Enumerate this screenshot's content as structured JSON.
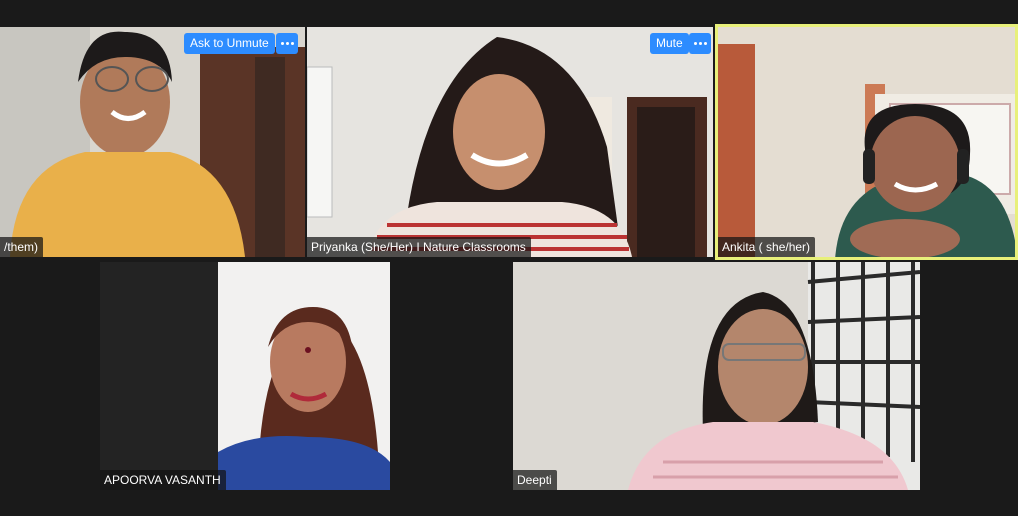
{
  "participants": [
    {
      "name": "/them)",
      "action": "Ask to Unmute"
    },
    {
      "name": "Priyanka (She/Her) I Nature Classrooms",
      "action": "Mute"
    },
    {
      "name": "Ankita ( she/her)"
    },
    {
      "name": "APOORVA VASANTH"
    },
    {
      "name": "Deepti"
    }
  ],
  "colors": {
    "button": "#2d8cff",
    "active_speaker": "#e8f07a",
    "background": "#1a1a1a"
  },
  "icons": {
    "more": "more-options-icon"
  }
}
